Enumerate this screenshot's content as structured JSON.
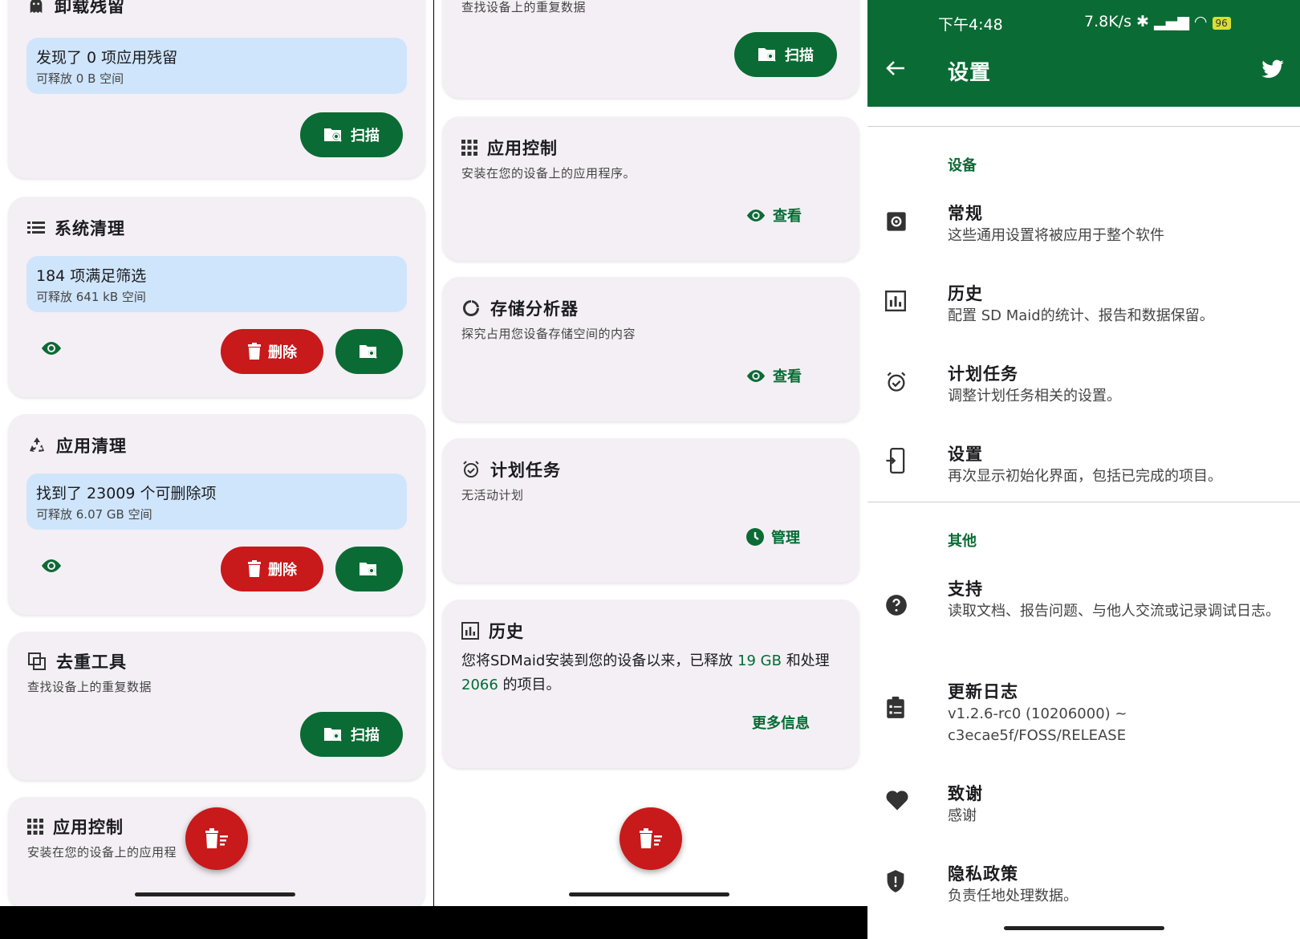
{
  "colors": {
    "primary": "#0b6b34",
    "danger": "#c8191b",
    "card": "#f4eff5",
    "info": "#cfe5fb"
  },
  "panel1": {
    "uninstall": {
      "title": "卸载残留",
      "icon": "ghost-icon",
      "info_main": "发现了 0 项应用残留",
      "info_sub": "可释放 0 B 空间",
      "scan_label": "扫描"
    },
    "system": {
      "title": "系统清理",
      "icon": "list-icon",
      "info_main": "184 项满足筛选",
      "info_sub": "可释放 641 kB 空间",
      "delete_label": "删除"
    },
    "app_clean": {
      "title": "应用清理",
      "icon": "recycle-icon",
      "info_main": "找到了 23009 个可删除项",
      "info_sub": "可释放 6.07 GB 空间",
      "delete_label": "删除"
    },
    "dedup": {
      "title": "去重工具",
      "icon": "duplicate-icon",
      "subtitle": "查找设备上的重复数据",
      "scan_label": "扫描"
    },
    "app_control": {
      "title": "应用控制",
      "icon": "grid-icon",
      "subtitle": "安装在您的设备上的应用程"
    }
  },
  "panel2": {
    "dedup_tail": {
      "subtitle": "查找设备上的重复数据",
      "scan_label": "扫描"
    },
    "app_control": {
      "title": "应用控制",
      "icon": "grid-icon",
      "subtitle": "安装在您的设备上的应用程序。",
      "view_label": "查看"
    },
    "analyzer": {
      "title": "存储分析器",
      "icon": "donut-icon",
      "subtitle": "探究占用您设备存储空间的内容",
      "view_label": "查看"
    },
    "scheduler": {
      "title": "计划任务",
      "icon": "alarm-icon",
      "subtitle": "无活动计划",
      "manage_label": "管理"
    },
    "history": {
      "title": "历史",
      "icon": "chart-icon",
      "text_1": "您将SDMaid安装到您的设备以来，已释放",
      "freed": "19 GB",
      "text_2": "和处理",
      "items": "2066",
      "text_3": "的项目。",
      "more_label": "更多信息"
    }
  },
  "panel3": {
    "status": {
      "time": "下午4:48",
      "net": "7.8K/s",
      "battery": "96"
    },
    "title": "设置",
    "section_device": "设备",
    "section_other": "其他",
    "items": [
      {
        "title": "常规",
        "desc": "这些通用设置将被应用于整个软件",
        "icon": "gear-icon"
      },
      {
        "title": "历史",
        "desc": "配置 SD Maid的统计、报告和数据保留。",
        "icon": "chart-icon"
      },
      {
        "title": "计划任务",
        "desc": "调整计划任务相关的设置。",
        "icon": "alarm-check-icon"
      },
      {
        "title": "设置",
        "desc": "再次显示初始化界面，包括已完成的项目。",
        "icon": "phone-setup-icon"
      },
      {
        "title": "支持",
        "desc": "读取文档、报告问题、与他人交流或记录调试日志。",
        "icon": "help-icon"
      },
      {
        "title": "更新日志",
        "desc": "v1.2.6-rc0 (10206000) ~ c3ecae5f/FOSS/RELEASE",
        "icon": "changelog-icon"
      },
      {
        "title": "致谢",
        "desc": "感谢",
        "icon": "heart-icon"
      },
      {
        "title": "隐私政策",
        "desc": "负责任地处理数据。",
        "icon": "shield-icon"
      }
    ]
  }
}
